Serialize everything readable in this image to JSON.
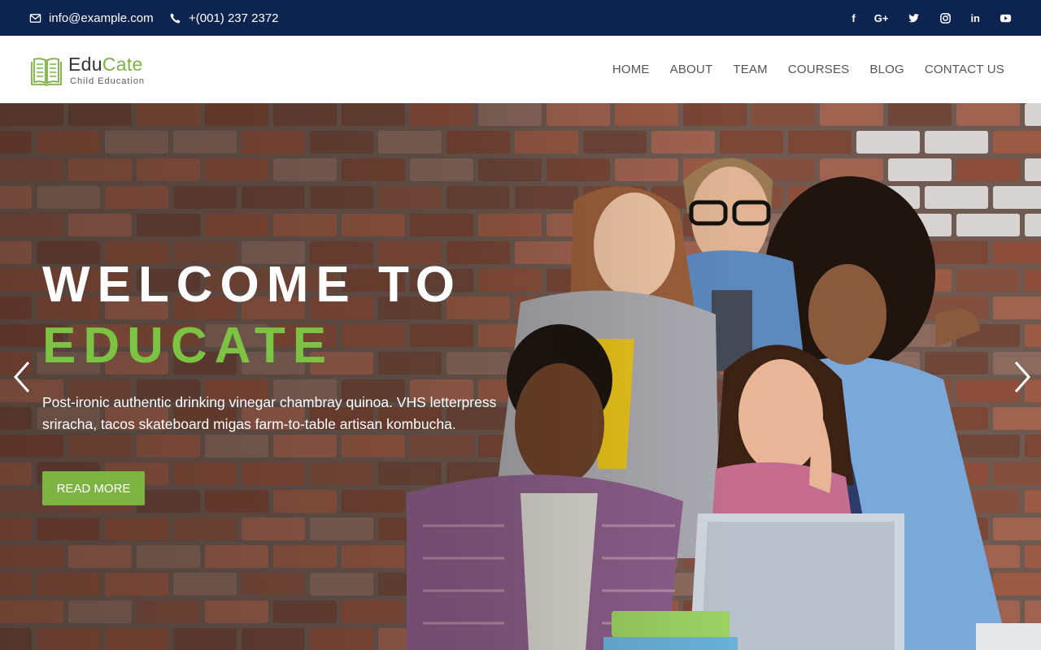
{
  "topbar": {
    "email": "info@example.com",
    "phone": "+(001) 237 2372",
    "socials": [
      {
        "name": "facebook-icon",
        "label": "f"
      },
      {
        "name": "google-plus-icon",
        "label": "G+"
      },
      {
        "name": "twitter-icon",
        "label": ""
      },
      {
        "name": "instagram-icon",
        "label": ""
      },
      {
        "name": "linkedin-icon",
        "label": "in"
      },
      {
        "name": "youtube-icon",
        "label": ""
      }
    ]
  },
  "header": {
    "logo_name_a": "Edu",
    "logo_name_b": "Cate",
    "logo_tagline": "Child Education",
    "nav": [
      "HOME",
      "ABOUT",
      "TEAM",
      "COURSES",
      "BLOG",
      "CONTACT US"
    ]
  },
  "hero": {
    "title_line1": "WELCOME TO",
    "title_line2": "EDUCATE",
    "description": "Post-ironic authentic drinking vinegar chambray quinoa. VHS letterpress sriracha, tacos skateboard migas farm-to-table artisan kombucha.",
    "button_label": "READ MORE"
  },
  "colors": {
    "topbar_bg": "#0d2350",
    "accent_green": "#7cb342",
    "title_green": "#7cc243"
  }
}
